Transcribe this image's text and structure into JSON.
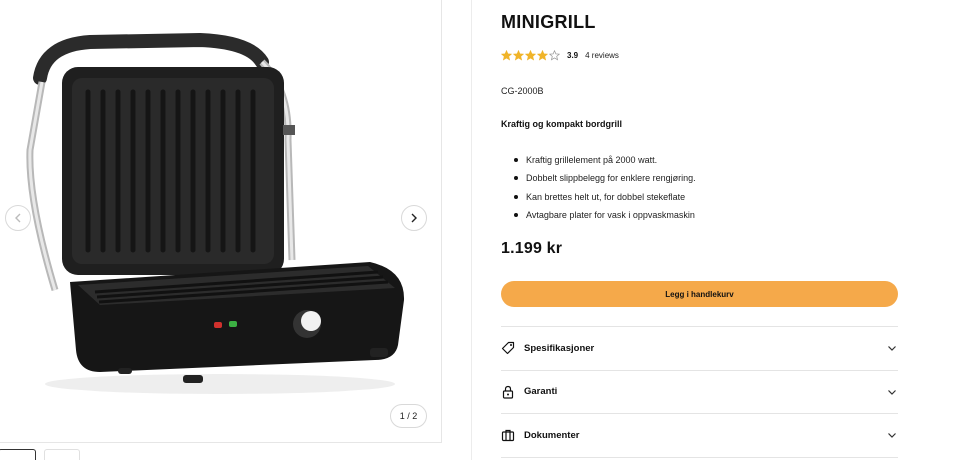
{
  "gallery": {
    "counter": "1 / 2",
    "image_alt": "Minigrill product photo",
    "icons": {
      "prev": "chevron-left-icon",
      "next": "chevron-right-icon"
    }
  },
  "product": {
    "title": "MINIGRILL",
    "rating": {
      "score": "3.9",
      "value": 3.9,
      "max": 5,
      "reviews": "4 reviews",
      "star_color": "#f0b429"
    },
    "sku": "CG-2000B",
    "subtitle": "Kraftig og kompakt bordgrill",
    "features": [
      "Kraftig grillelement på 2000 watt.",
      "Dobbelt slippbelegg for enklere rengjøring.",
      "Kan brettes helt ut, for dobbel stekeflate",
      "Avtagbare plater for vask i oppvaskmaskin"
    ],
    "price": "1.199 kr",
    "cart_button": "Legg i handlekurv",
    "accent_color": "#f5a94a"
  },
  "accordion": [
    {
      "label": "Spesifikasjoner",
      "icon": "tag-icon"
    },
    {
      "label": "Garanti",
      "icon": "lock-icon"
    },
    {
      "label": "Dokumenter",
      "icon": "briefcase-icon"
    }
  ]
}
